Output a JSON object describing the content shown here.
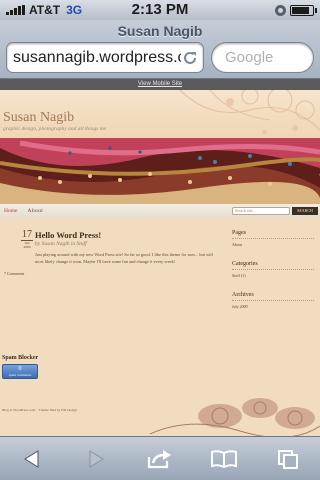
{
  "status": {
    "carrier": "AT&T",
    "network": "3G",
    "time": "2:13 PM"
  },
  "browser": {
    "page_title": "Susan  Nagib",
    "url": "susannagib.wordpress.com",
    "search_placeholder": "Google"
  },
  "site": {
    "mobile_link": "View Mobile Site",
    "title": "Susan Nagib",
    "tagline": "graphic design, photography and all things me",
    "nav": {
      "home": "Home",
      "about": "About",
      "search_placeholder": "Search site...",
      "search_button": "SEARCH"
    },
    "post": {
      "day": "17",
      "month": "Jun",
      "year": "2009",
      "comments": "7 Comments",
      "title": "Hello Word Press!",
      "meta": "by Susan Nagib  in Stuff",
      "body": "Just playing around with my new Word Press site! So far so good. I like this theme for now... but will most likely change it soon. Maybe I'll have some fun and change it every week!"
    },
    "sidebar": {
      "pages_heading": "Pages",
      "pages_item": "About",
      "categories_heading": "Categories",
      "categories_item": "Stuff (1)",
      "archives_heading": "Archives",
      "archives_item": "July 2009"
    },
    "spam": {
      "heading": "Spam Blocker",
      "count": "0",
      "label": "spam comments"
    },
    "footer": "Blog at WordPress.com.  ·  Theme: Bad by ND Design"
  },
  "colors": {
    "page_bg": "#f2dcbf",
    "accent": "#c23a2b",
    "toolbar": "#a7b2c1"
  },
  "icons": [
    "reload-icon",
    "back-icon",
    "forward-icon",
    "share-icon",
    "bookmarks-icon",
    "pages-icon"
  ]
}
